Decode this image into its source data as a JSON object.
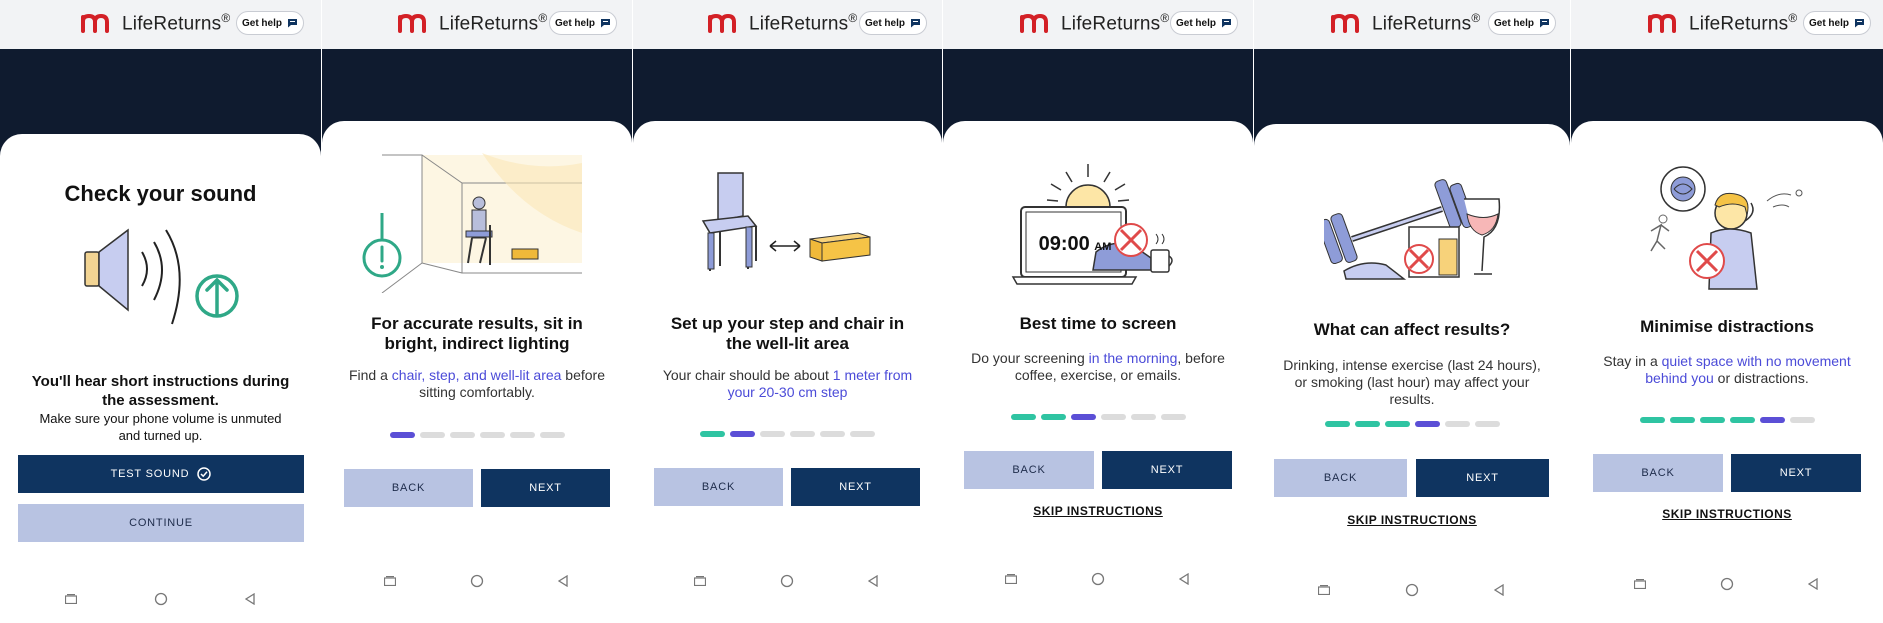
{
  "app": {
    "brand": "LifeReturns",
    "brand_mark": "®",
    "get_help": "Get help",
    "logo_icon": "m-logo-icon",
    "help_icon": "chat-bubble-icon"
  },
  "colors": {
    "accent_navy": "#0f3460",
    "back_button": "#b8c3e2",
    "highlight_text": "#4b4bd8",
    "progress_done": "#2fc4a2",
    "progress_current": "#5b4fd6",
    "progress_todo": "#dcdcdc",
    "logo_red": "#d32026",
    "dark_band": "#0f1b2f"
  },
  "buttons": {
    "back": "BACK",
    "next": "NEXT",
    "skip": "SKIP INSTRUCTIONS"
  },
  "screens": [
    {
      "title": "Check your sound",
      "subtitle": "You'll hear short instructions during the assessment.",
      "body": "Make sure your phone volume is unmuted and turned up.",
      "primary_button": "TEST SOUND",
      "secondary_button": "CONTINUE",
      "illustration": "speaker-volume-up-icon"
    },
    {
      "title": "For accurate results, sit in bright, indirect lighting",
      "body_parts": [
        "Find a ",
        "chair, step, and well-lit area",
        " before sitting comfortably."
      ],
      "progress": {
        "step": 1,
        "total": 6
      },
      "illustration": "person-seated-room-warning-icon"
    },
    {
      "title": "Set up your step and chair in the well-lit area",
      "body_parts": [
        "Your chair should be about ",
        "1 meter from your 20-30 cm step"
      ],
      "progress": {
        "step": 2,
        "total": 6
      },
      "illustration": "chair-and-step-icon"
    },
    {
      "title": "Best time to screen",
      "body_parts": [
        "Do your screening ",
        "in the morning",
        ", before coffee, exercise, or emails."
      ],
      "clock": {
        "time": "09:00",
        "ampm": "AM"
      },
      "progress": {
        "step": 3,
        "total": 6
      },
      "illustration": "morning-laptop-icon"
    },
    {
      "title": "What can affect results?",
      "body": "Drinking, intense exercise (last 24 hours), or smoking (last hour) may affect your results.",
      "progress": {
        "step": 4,
        "total": 6
      },
      "illustration": "dumbbells-drinks-icon"
    },
    {
      "title": "Minimise distractions",
      "body_parts": [
        "Stay in a ",
        "quiet space with no movement behind you",
        " or distractions."
      ],
      "progress": {
        "step": 5,
        "total": 6
      },
      "illustration": "distracted-person-icon"
    }
  ]
}
